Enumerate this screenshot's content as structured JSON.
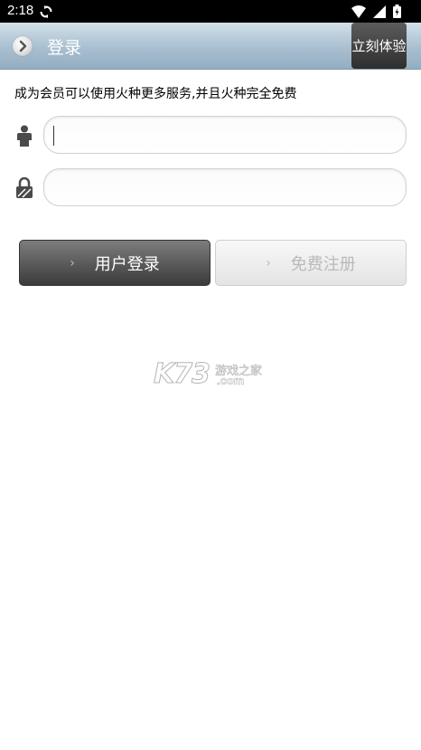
{
  "status_bar": {
    "time": "2:18",
    "icons": [
      "sync-icon",
      "wifi-icon",
      "signal-icon",
      "battery-icon"
    ]
  },
  "header": {
    "title": "登录",
    "back_icon": "chevron-right-circle-icon",
    "try_button": "立刻体验"
  },
  "intro_text": "成为会员可以使用火种更多服务,并且火种完全免费",
  "form": {
    "username_icon": "person-icon",
    "username_value": "",
    "password_icon": "lock-icon",
    "password_value": ""
  },
  "buttons": {
    "login_label": "用户登录",
    "register_label": "免费注册"
  },
  "watermark": {
    "brand": "K73",
    "tagline": "游戏之家",
    "domain": ".com"
  },
  "colors": {
    "header_gradient_top": "#d2e0ea",
    "header_gradient_bottom": "#93adc2",
    "login_button": "#3b3b3b",
    "register_button": "#e4e4e4"
  }
}
